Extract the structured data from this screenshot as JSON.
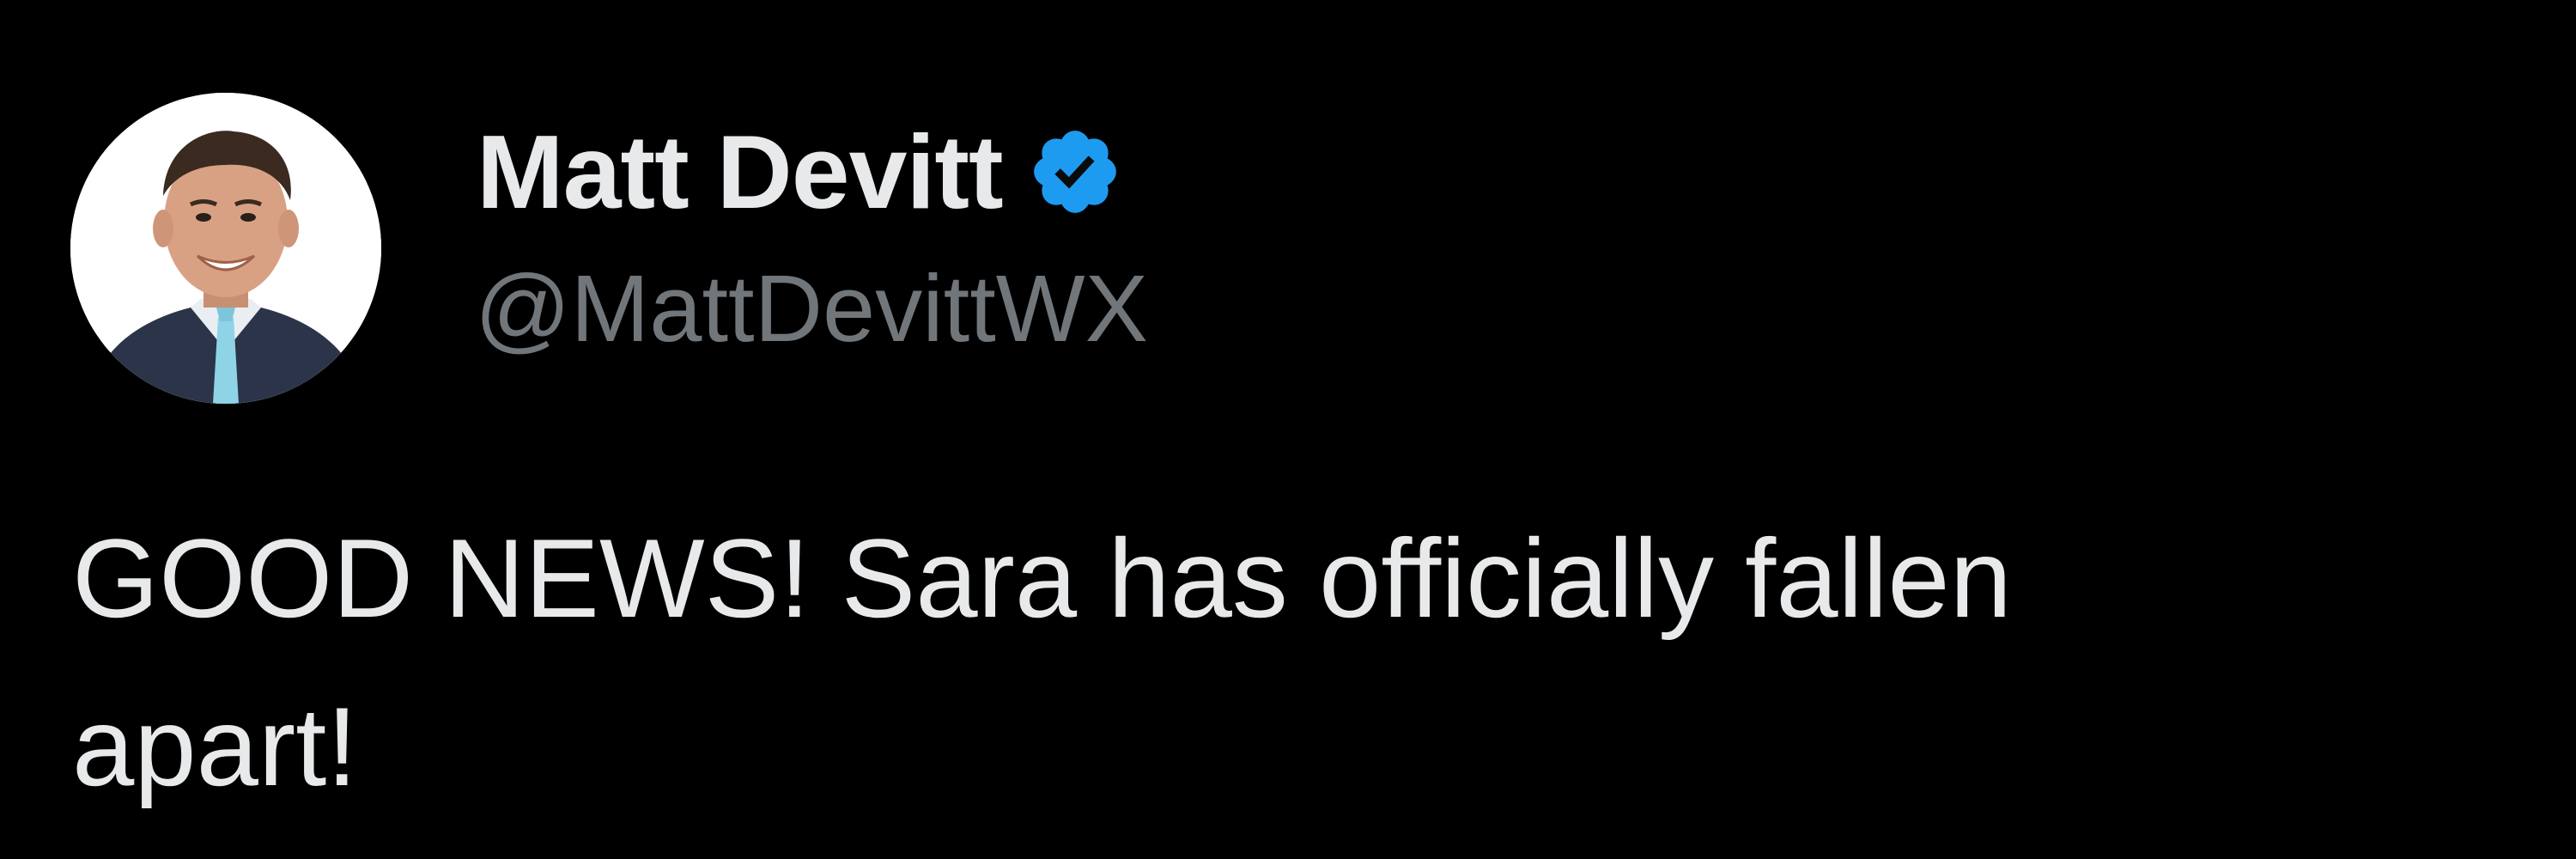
{
  "author": {
    "display_name": "Matt Devitt",
    "handle": "@MattDevittWX",
    "verified": true,
    "verified_icon": "verified-badge-icon",
    "avatar_icon": "avatar"
  },
  "tweet": {
    "text_line_1": "GOOD NEWS! Sara has officially fallen",
    "text_line_2": "apart!"
  },
  "colors": {
    "background": "#000000",
    "primary_text": "#e7e9ea",
    "secondary_text": "#71767b",
    "verified_blue": "#1d9bf0"
  }
}
